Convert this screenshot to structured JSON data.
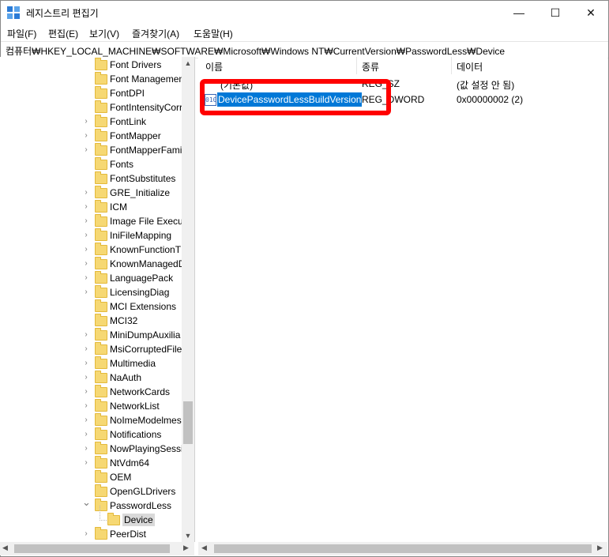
{
  "window": {
    "title": "레지스트리 편집기",
    "controls": {
      "minimize": "—",
      "maximize": "☐",
      "close": "✕"
    }
  },
  "menubar": [
    "파일(F)",
    "편집(E)",
    "보기(V)",
    "즐겨찾기(A)",
    "도움말(H)"
  ],
  "address": "컴퓨터₩HKEY_LOCAL_MACHINE₩SOFTWARE₩Microsoft₩Windows NT₩CurrentVersion₩PasswordLess₩Device",
  "tree": {
    "items": [
      {
        "label": "Font Drivers",
        "expandable": false
      },
      {
        "label": "Font Managemen",
        "expandable": false
      },
      {
        "label": "FontDPI",
        "expandable": false
      },
      {
        "label": "FontIntensityCorr",
        "expandable": false
      },
      {
        "label": "FontLink",
        "expandable": true
      },
      {
        "label": "FontMapper",
        "expandable": true
      },
      {
        "label": "FontMapperFamil",
        "expandable": true
      },
      {
        "label": "Fonts",
        "expandable": false
      },
      {
        "label": "FontSubstitutes",
        "expandable": false
      },
      {
        "label": "GRE_Initialize",
        "expandable": true
      },
      {
        "label": "ICM",
        "expandable": true
      },
      {
        "label": "Image File Execu",
        "expandable": true
      },
      {
        "label": "IniFileMapping",
        "expandable": true
      },
      {
        "label": "KnownFunctionT",
        "expandable": true
      },
      {
        "label": "KnownManagedD",
        "expandable": true
      },
      {
        "label": "LanguagePack",
        "expandable": true
      },
      {
        "label": "LicensingDiag",
        "expandable": true
      },
      {
        "label": "MCI Extensions",
        "expandable": false
      },
      {
        "label": "MCI32",
        "expandable": false
      },
      {
        "label": "MiniDumpAuxilia",
        "expandable": true
      },
      {
        "label": "MsiCorruptedFile",
        "expandable": true
      },
      {
        "label": "Multimedia",
        "expandable": true
      },
      {
        "label": "NaAuth",
        "expandable": true
      },
      {
        "label": "NetworkCards",
        "expandable": true
      },
      {
        "label": "NetworkList",
        "expandable": true
      },
      {
        "label": "NoImeModelmes",
        "expandable": true
      },
      {
        "label": "Notifications",
        "expandable": true
      },
      {
        "label": "NowPlayingSessi",
        "expandable": true
      },
      {
        "label": "NtVdm64",
        "expandable": true
      },
      {
        "label": "OEM",
        "expandable": false
      },
      {
        "label": "OpenGLDrivers",
        "expandable": false
      },
      {
        "label": "PasswordLess",
        "expandable": true,
        "expanded": true
      },
      {
        "label": "Device",
        "expandable": false,
        "selected": true,
        "child": true
      },
      {
        "label": "PeerDist",
        "expandable": true
      }
    ]
  },
  "list": {
    "columns": [
      "이름",
      "종류",
      "데이터"
    ],
    "rows": [
      {
        "name": "(기본값)",
        "type": "REG_SZ",
        "data": "(값 설정 안 됨)"
      },
      {
        "name": "DevicePasswordLessBuildVersion",
        "type": "REG_DWORD",
        "data": "0x00000002 (2)"
      }
    ]
  },
  "colors": {
    "highlight": "#0078d7",
    "callout": "#ff0000",
    "folder": "#f6d873"
  }
}
